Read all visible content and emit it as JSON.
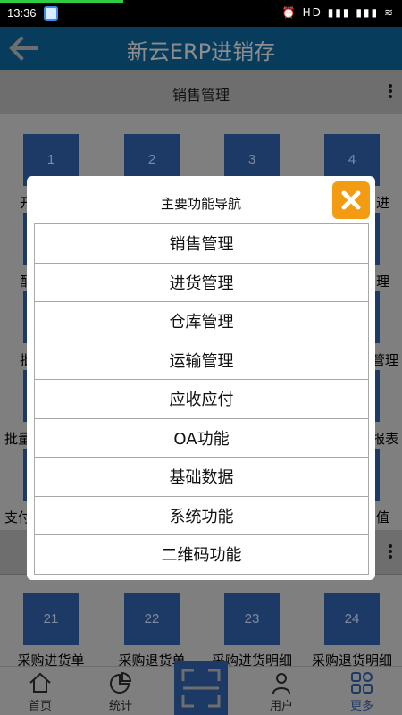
{
  "status_bar": {
    "time": "13:36",
    "indicators": "⏰ HD ▮▮▮ ▮▮▮ ≋"
  },
  "header": {
    "title": "新云ERP进销存"
  },
  "section_top": {
    "label": "销售管理"
  },
  "tiles_top": [
    "1",
    "2",
    "3",
    "4"
  ],
  "edge_labels": {
    "left": [
      "开",
      "配",
      "批",
      "批量",
      "支付"
    ],
    "right": [
      "进",
      "理",
      "管理",
      "报表",
      "值"
    ]
  },
  "tiles_bottom": {
    "numbers": [
      "21",
      "22",
      "23",
      "24"
    ],
    "labels": [
      "采购进货单",
      "采购退货单",
      "采购进货明细",
      "采购退货明细"
    ]
  },
  "bottom_nav": {
    "items": [
      "首页",
      "统计",
      "用户",
      "更多"
    ]
  },
  "modal": {
    "title": "主要功能导航",
    "items": [
      "销售管理",
      "进货管理",
      "仓库管理",
      "运输管理",
      "应收应付",
      "OA功能",
      "基础数据",
      "系统功能",
      "二维码功能"
    ]
  }
}
